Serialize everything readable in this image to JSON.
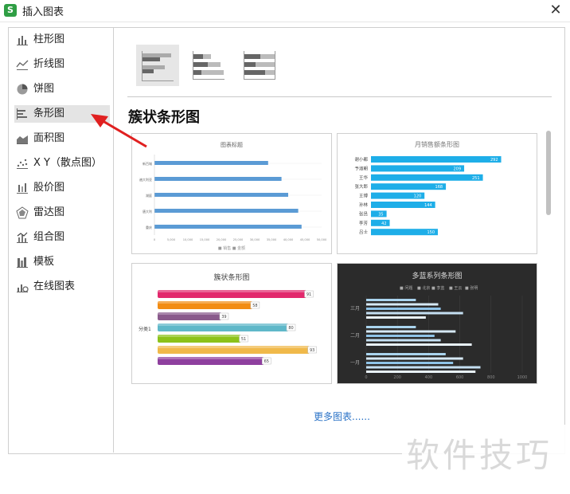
{
  "window": {
    "title": "插入图表",
    "close_glyph": "✕",
    "app_icon_letter": "S"
  },
  "sidebar": {
    "items": [
      {
        "label": "柱形图",
        "icon": "column-chart-icon"
      },
      {
        "label": "折线图",
        "icon": "line-chart-icon"
      },
      {
        "label": "饼图",
        "icon": "pie-chart-icon"
      },
      {
        "label": "条形图",
        "icon": "bar-chart-icon",
        "selected": true
      },
      {
        "label": "面积图",
        "icon": "area-chart-icon"
      },
      {
        "label": "X Y（散点图）",
        "icon": "scatter-chart-icon"
      },
      {
        "label": "股价图",
        "icon": "stock-chart-icon"
      },
      {
        "label": "雷达图",
        "icon": "radar-chart-icon"
      },
      {
        "label": "组合图",
        "icon": "combo-chart-icon"
      },
      {
        "label": "模板",
        "icon": "template-icon"
      },
      {
        "label": "在线图表",
        "icon": "online-chart-icon"
      }
    ]
  },
  "main": {
    "section_title": "簇状条形图",
    "more_link": "更多图表......"
  },
  "cards": {
    "card1": {
      "title": "图表标题",
      "categories": [
        "新百城",
        "遍大利亚",
        "湖庭",
        "唐大利",
        "重庆"
      ],
      "values": [
        34000,
        38000,
        40000,
        43000,
        44000
      ],
      "xticks": [
        "0",
        "5,000",
        "10,000",
        "15,000",
        "20,000",
        "25,000",
        "30,000",
        "35,000",
        "40,000",
        "45,000",
        "50,000"
      ],
      "legend": "■ 销售 ■ 金额",
      "color": "#5b9bd5"
    },
    "card2": {
      "title": "月销售额条形图",
      "categories": [
        "谢小都",
        "予淑朝",
        "王华",
        "张大郎",
        "王博",
        "孙林",
        "张员",
        "李芳",
        "吕士"
      ],
      "values": [
        292,
        209,
        251,
        168,
        120,
        144,
        35,
        42,
        150
      ],
      "color": "#1eaee8"
    },
    "card3": {
      "title": "簇状条形图",
      "category": "分类1",
      "values": [
        91,
        58,
        39,
        80,
        51,
        93,
        65
      ],
      "colors": [
        "#e2286c",
        "#f28c14",
        "#8a5a8c",
        "#5fb8c9",
        "#8cc21a",
        "#f0b94a",
        "#8e3f9e"
      ]
    },
    "card4": {
      "title": "多蓝系列条形图",
      "legend": [
        "■ 问题",
        "■ 北京",
        "■ 李蓝",
        "■ 王云",
        "■ 张明"
      ],
      "groups": [
        "三月",
        "二月",
        "一月"
      ],
      "xticks": [
        "0",
        "200",
        "400",
        "600",
        "800",
        "1000"
      ]
    }
  },
  "watermark": "软件技巧",
  "colors": {
    "accent_arrow": "#e02020",
    "link": "#2b73c7",
    "selection_bg": "#e4e4e4"
  }
}
